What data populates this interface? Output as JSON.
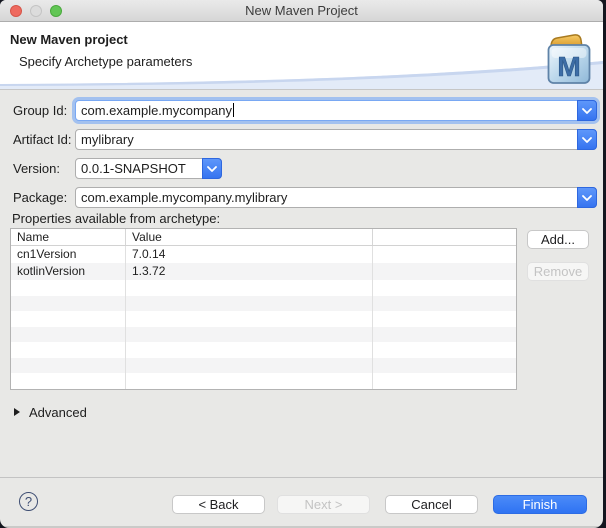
{
  "window": {
    "title": "New Maven Project"
  },
  "titlebar": {
    "close": "close",
    "minimize": "minimize",
    "zoom": "zoom"
  },
  "banner": {
    "title": "New Maven project",
    "subtitle": "Specify Archetype parameters",
    "icon": "maven-folder-icon",
    "icon_letter": "M"
  },
  "form": {
    "fields": [
      {
        "label": "Group Id:",
        "value": "com.example.mycompany",
        "focused": true,
        "width": "full"
      },
      {
        "label": "Artifact Id:",
        "value": "mylibrary",
        "focused": false,
        "width": "full"
      },
      {
        "label": "Version:",
        "value": "0.0.1-SNAPSHOT",
        "focused": false,
        "width": "short"
      },
      {
        "label": "Package:",
        "value": "com.example.mycompany.mylibrary",
        "focused": false,
        "width": "full"
      }
    ]
  },
  "properties": {
    "label": "Properties available from archetype:",
    "table": {
      "columns": [
        "Name",
        "Value",
        ""
      ],
      "rows": [
        [
          "cn1Version",
          "7.0.14"
        ],
        [
          "kotlinVersion",
          "1.3.72"
        ]
      ]
    },
    "add_label": "Add...",
    "remove_label": "Remove",
    "remove_enabled": false
  },
  "advanced": {
    "label": "Advanced",
    "expanded": false
  },
  "footer": {
    "help_label": "?",
    "back_label": "< Back",
    "next_label": "Next >",
    "cancel_label": "Cancel",
    "finish_label": "Finish",
    "next_enabled": false
  },
  "colors": {
    "accent_blue": "#3674f0",
    "finish_blue": "#2f73f2",
    "window_bg": "#e8e8e6",
    "banner_bg": "#ffffff",
    "traffic_red": "#ee6a5f",
    "traffic_green": "#62c655",
    "table_stripe": "#f4f4f5",
    "help_outline": "#3e4e73"
  }
}
